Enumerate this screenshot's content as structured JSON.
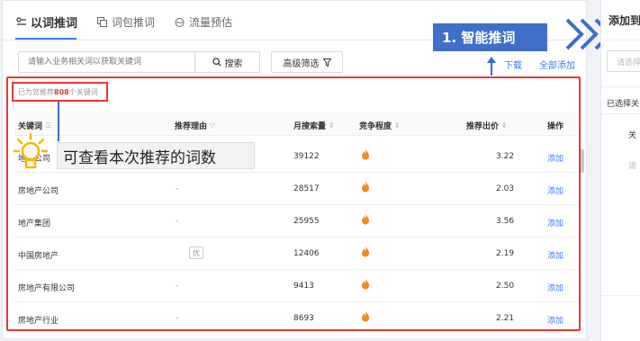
{
  "tabs": [
    {
      "label": "以词推词",
      "icon": "keyword-icon",
      "active": true
    },
    {
      "label": "词包推词",
      "icon": "package-icon",
      "active": false
    },
    {
      "label": "流量预估",
      "icon": "traffic-icon",
      "active": false
    }
  ],
  "search": {
    "placeholder": "请输入业务相关词以获取关键词",
    "button": "搜索"
  },
  "filter": {
    "label": "高级筛选"
  },
  "annotation": {
    "badge": "1. 智能推词",
    "callout": "可查看本次推荐的词数"
  },
  "links": {
    "download": "下载",
    "add_all": "全部添加"
  },
  "summary": {
    "prefix": "已为您推荐",
    "count": "808",
    "suffix": "个关键词"
  },
  "table": {
    "headers": {
      "keyword": "关键词",
      "reason": "推荐理由",
      "search": "月搜索量",
      "competition": "竞争程度",
      "bid": "推荐出价",
      "action": "操作"
    },
    "rows": [
      {
        "keyword": "地产公司",
        "reason": "",
        "search": "39122",
        "bid": "3.22",
        "action": "添加"
      },
      {
        "keyword": "房地产公司",
        "reason": "-",
        "search": "28517",
        "bid": "2.03",
        "action": "添加"
      },
      {
        "keyword": "地产集团",
        "reason": "-",
        "search": "25955",
        "bid": "3.56",
        "action": "添加"
      },
      {
        "keyword": "中国房地产",
        "reason": "优",
        "search": "12406",
        "bid": "2.19",
        "action": "添加"
      },
      {
        "keyword": "房地产有限公司",
        "reason": "-",
        "search": "9413",
        "bid": "2.50",
        "action": "添加"
      },
      {
        "keyword": "房地产行业",
        "reason": "-",
        "search": "8693",
        "bid": "2.21",
        "action": "添加"
      }
    ]
  },
  "right_panel": {
    "title": "添加到",
    "input": "请选择",
    "selected": "已选择关",
    "col": "关",
    "placeholder": "请"
  },
  "colors": {
    "accent": "#3a7bf7",
    "annotation_red": "#e53935",
    "badge_blue": "#3f6fc8",
    "flame": "#f08a24"
  }
}
